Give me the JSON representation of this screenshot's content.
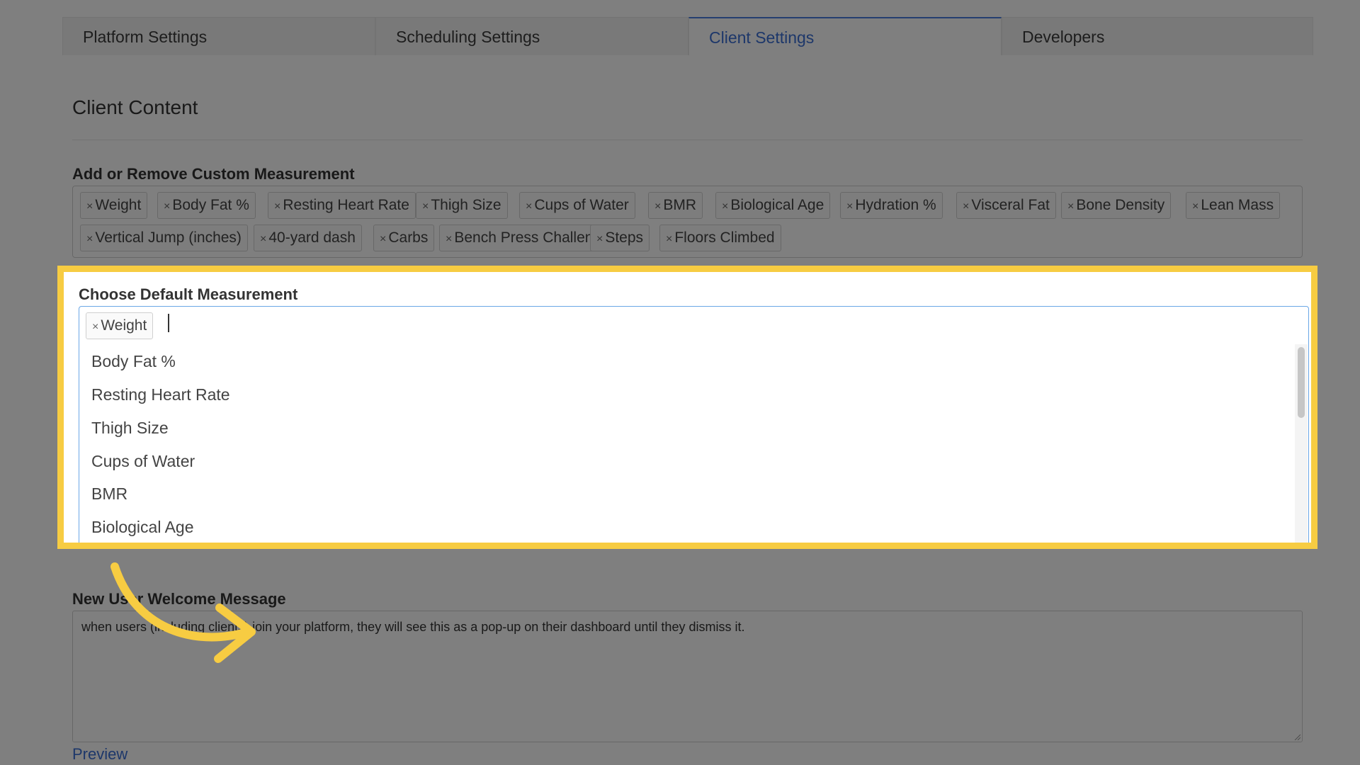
{
  "tabs": [
    {
      "label": "Platform Settings"
    },
    {
      "label": "Scheduling Settings"
    },
    {
      "label": "Client Settings",
      "active": true
    },
    {
      "label": "Developers"
    }
  ],
  "section_title": "Client Content",
  "custom_measurement": {
    "label": "Add or Remove Custom Measurement",
    "remove_symbol": "×",
    "tags": [
      "Weight",
      "Body Fat %",
      "Resting Heart Rate",
      "Thigh Size",
      "Cups of Water",
      "BMR",
      "Biological Age",
      "Hydration %",
      "Visceral Fat",
      "Bone Density",
      "Lean Mass",
      "Vertical Jump (inches)",
      "40-yard dash",
      "Carbs",
      "Bench Press Challenge",
      "Steps",
      "Floors Climbed"
    ]
  },
  "default_measurement": {
    "label": "Choose Default Measurement",
    "selected": "Weight",
    "options": [
      "Body Fat %",
      "Resting Heart Rate",
      "Thigh Size",
      "Cups of Water",
      "BMR",
      "Biological Age"
    ],
    "hidden_link": "Preview"
  },
  "welcome": {
    "label": "New User Welcome Message",
    "placeholder": "when users (including clients) join your platform, they will see this as a pop-up on their dashboard until they dismiss it.",
    "preview_link": "Preview"
  },
  "colors": {
    "highlight": "#f7cc42",
    "link": "#3b6fd4",
    "overlay": "rgba(0,0,0,0.5)"
  }
}
